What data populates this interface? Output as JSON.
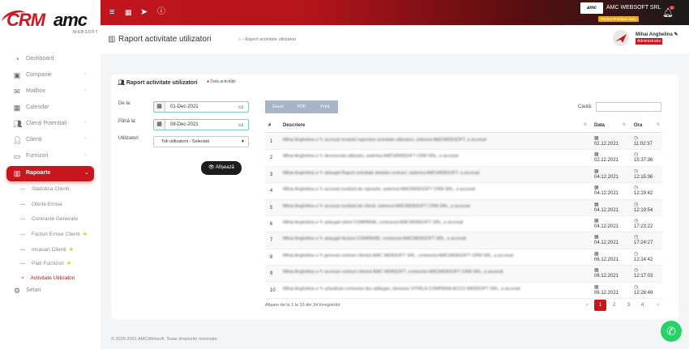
{
  "topbar": {
    "menu_icon": "hamburger-icon",
    "company_logo_text": "amc",
    "company_name": "AMC WEBSOFT SRL",
    "company_badge": "Pachet Premium activ",
    "notification_count": "6"
  },
  "logo": {
    "crm": "CRM",
    "amc": "amc",
    "sub": "WEBSOFT"
  },
  "sidebar": {
    "items": [
      {
        "label": "Dashboard",
        "icon": "dashboard-icon",
        "chevron": ""
      },
      {
        "label": "Companie",
        "icon": "company-icon",
        "chevron": "›"
      },
      {
        "label": "Mailbox",
        "icon": "mail-icon",
        "chevron": "›"
      },
      {
        "label": "Calendar",
        "icon": "calendar-icon",
        "chevron": ""
      },
      {
        "label": "Clienți Potențiali",
        "icon": "users-icon",
        "chevron": "›"
      },
      {
        "label": "Clienți",
        "icon": "user-icon",
        "chevron": "›"
      },
      {
        "label": "Furnizori",
        "icon": "truck-icon",
        "chevron": "›"
      },
      {
        "label": "Rapoarte",
        "icon": "chart-icon",
        "chevron": "⌄"
      }
    ],
    "subitems": [
      {
        "label": "Statistica Clienti",
        "star": ""
      },
      {
        "label": "Oferte Emise",
        "star": ""
      },
      {
        "label": "Contracte Generate",
        "star": ""
      },
      {
        "label": "Facturi Emise Clienti",
        "star": "★"
      },
      {
        "label": "Incasari Clienti",
        "star": "★"
      },
      {
        "label": "Plati Furnizori",
        "star": "★"
      },
      {
        "label": "Activitate Utilizatori",
        "star": ""
      }
    ],
    "partial_item": "Setari"
  },
  "header": {
    "title": "Raport activitate utilizatori",
    "breadcrumb": "⌂ › Raport activitate utilizatori",
    "user_name": "Mihai Anghelina ✎",
    "user_role": "Administrator"
  },
  "card": {
    "title": "Raport activitate utilizatori",
    "subtitle": "Data activității",
    "from_label": "De la:",
    "from_value": "01-Dec-2021",
    "to_label": "Până la:",
    "to_value": "08-Dec-2021",
    "users_label": "Utilizatori",
    "users_value": "Toti utilizatorii - Selectati",
    "show_button": "👁 Afișează",
    "export_buttons": [
      "Excel",
      "PDF",
      "Print"
    ],
    "search_label": "Caută:",
    "search_placeholder": ""
  },
  "table": {
    "columns": [
      "#",
      "Descriere",
      "Data",
      "Ora"
    ],
    "rows": [
      {
        "nr": "1",
        "desc": "Mihai Anghelina a ✎ accesat modulul raportare activitate utilizatori, sistemul AMCWEBSOFT, a accesat",
        "date": "02.12.2021",
        "time": "11:02:37"
      },
      {
        "nr": "2",
        "desc": "Mihai Anghelina a ✎ deconectat utilizator, sistemul AMCWEBSOFT CRM SRL, a accesat",
        "date": "02.12.2021",
        "time": "15:37:36"
      },
      {
        "nr": "3",
        "desc": "Mihai Anghelina a ✎ adaugat Raport activitate detaliat contract, sistemul AMCWEBSOFT, a accesat",
        "date": "04.12.2021",
        "time": "12:15:36"
      },
      {
        "nr": "4",
        "desc": "Mihai Anghelina a ✎ accesat modulul de rapoarte, sistemul AMCWEBSOFT CRM SRL, a accesat",
        "date": "04.12.2021",
        "time": "12:19:42"
      },
      {
        "nr": "5",
        "desc": "Mihai Anghelina a ✎ accesat modulul de clienti, sistemul AMCWEBSOFT CRM SRL, a accesat",
        "date": "04.12.2021",
        "time": "12:19:54"
      },
      {
        "nr": "6",
        "desc": "Mihai Anghelina a ✎ adaugat client COMPANIE, contractul AMCWEBSOFT SRL, a accesat",
        "date": "04.12.2021",
        "time": "17:23:22"
      },
      {
        "nr": "7",
        "desc": "Mihai Anghelina a ✎ adaugat factura COMPANIE, contractul AMCWEBSOFT SRL, a accesat",
        "date": "04.12.2021",
        "time": "17:24:27"
      },
      {
        "nr": "8",
        "desc": "Mihai Anghelina a ✎ generat contract clientul AMC WEBSOFT SRL, contractul AMCWEBSOFT CRM SRL, a accesat",
        "date": "06.12.2021",
        "time": "12:14:42"
      },
      {
        "nr": "9",
        "desc": "Mihai Anghelina a ✎ accesat contract clientul AMC WEBSOFT, contractul AMCWEBSOFT CRM SRL, a accesat",
        "date": "06.12.2021",
        "time": "12:17:03"
      },
      {
        "nr": "10",
        "desc": "Mihai Anghelina a ✎ actualizat contractul des adăugat, clientului VITRILA COMPANIA ACCO WEBSOFT SRL, a accesat",
        "date": "06.12.2021",
        "time": "12:26:49"
      }
    ],
    "info": "Afișare de la 1 la 10 din 34 înregistrări",
    "pages": [
      "‹",
      "1",
      "2",
      "3",
      "4",
      "›"
    ]
  },
  "footer": {
    "copyright": "© 2020-2021 AMCWebsoft. Toate drepturile rezervate."
  },
  "colors": {
    "brand": "#c8161d",
    "whatsapp": "#25d366",
    "export": "#a9b4c8"
  }
}
